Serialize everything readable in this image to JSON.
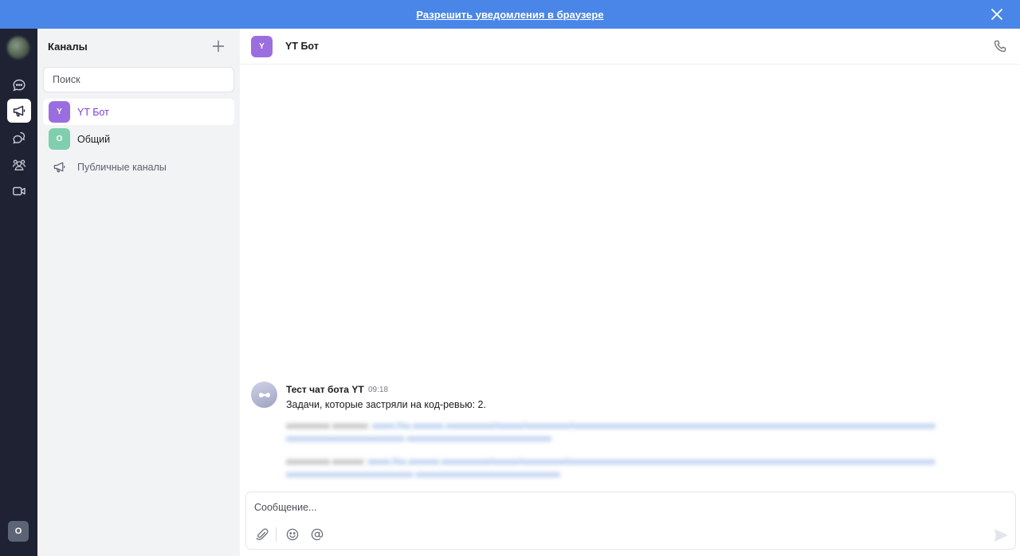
{
  "banner": {
    "text": "Разрешить уведомления в браузере"
  },
  "rail": {
    "user_initial": "О"
  },
  "sidebar": {
    "title": "Каналы",
    "search_placeholder": "Поиск",
    "channels": [
      {
        "initial": "Y",
        "label": "YT Бот",
        "color": "#9b6ee0",
        "active": true
      },
      {
        "initial": "О",
        "label": "Общий",
        "color": "#7fcfae",
        "active": false
      }
    ],
    "public_label": "Публичные каналы"
  },
  "chat": {
    "avatar_initial": "Y",
    "title": "YT Бот",
    "message": {
      "author": "Тест чат бота YT",
      "time": "09:18",
      "text": "Задачи, которые застряли на код-ревью: 2."
    },
    "composer_placeholder": "Сообщение..."
  },
  "colors": {
    "banner": "#4a86e8",
    "rail": "#1e2233",
    "accent": "#7b3fd4"
  }
}
